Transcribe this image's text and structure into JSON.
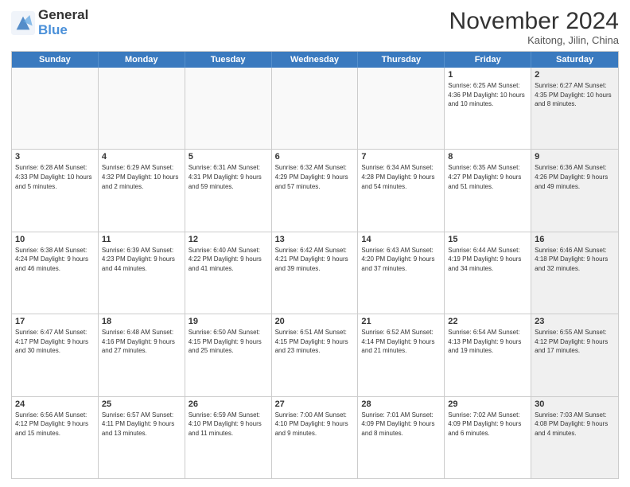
{
  "logo": {
    "line1": "General",
    "line2": "Blue"
  },
  "title": "November 2024",
  "location": "Kaitong, Jilin, China",
  "weekdays": [
    "Sunday",
    "Monday",
    "Tuesday",
    "Wednesday",
    "Thursday",
    "Friday",
    "Saturday"
  ],
  "rows": [
    [
      {
        "day": "",
        "info": "",
        "shaded": false,
        "empty": true
      },
      {
        "day": "",
        "info": "",
        "shaded": false,
        "empty": true
      },
      {
        "day": "",
        "info": "",
        "shaded": false,
        "empty": true
      },
      {
        "day": "",
        "info": "",
        "shaded": false,
        "empty": true
      },
      {
        "day": "",
        "info": "",
        "shaded": false,
        "empty": true
      },
      {
        "day": "1",
        "info": "Sunrise: 6:25 AM\nSunset: 4:36 PM\nDaylight: 10 hours and 10 minutes.",
        "shaded": false,
        "empty": false
      },
      {
        "day": "2",
        "info": "Sunrise: 6:27 AM\nSunset: 4:35 PM\nDaylight: 10 hours and 8 minutes.",
        "shaded": true,
        "empty": false
      }
    ],
    [
      {
        "day": "3",
        "info": "Sunrise: 6:28 AM\nSunset: 4:33 PM\nDaylight: 10 hours and 5 minutes.",
        "shaded": false,
        "empty": false
      },
      {
        "day": "4",
        "info": "Sunrise: 6:29 AM\nSunset: 4:32 PM\nDaylight: 10 hours and 2 minutes.",
        "shaded": false,
        "empty": false
      },
      {
        "day": "5",
        "info": "Sunrise: 6:31 AM\nSunset: 4:31 PM\nDaylight: 9 hours and 59 minutes.",
        "shaded": false,
        "empty": false
      },
      {
        "day": "6",
        "info": "Sunrise: 6:32 AM\nSunset: 4:29 PM\nDaylight: 9 hours and 57 minutes.",
        "shaded": false,
        "empty": false
      },
      {
        "day": "7",
        "info": "Sunrise: 6:34 AM\nSunset: 4:28 PM\nDaylight: 9 hours and 54 minutes.",
        "shaded": false,
        "empty": false
      },
      {
        "day": "8",
        "info": "Sunrise: 6:35 AM\nSunset: 4:27 PM\nDaylight: 9 hours and 51 minutes.",
        "shaded": false,
        "empty": false
      },
      {
        "day": "9",
        "info": "Sunrise: 6:36 AM\nSunset: 4:26 PM\nDaylight: 9 hours and 49 minutes.",
        "shaded": true,
        "empty": false
      }
    ],
    [
      {
        "day": "10",
        "info": "Sunrise: 6:38 AM\nSunset: 4:24 PM\nDaylight: 9 hours and 46 minutes.",
        "shaded": false,
        "empty": false
      },
      {
        "day": "11",
        "info": "Sunrise: 6:39 AM\nSunset: 4:23 PM\nDaylight: 9 hours and 44 minutes.",
        "shaded": false,
        "empty": false
      },
      {
        "day": "12",
        "info": "Sunrise: 6:40 AM\nSunset: 4:22 PM\nDaylight: 9 hours and 41 minutes.",
        "shaded": false,
        "empty": false
      },
      {
        "day": "13",
        "info": "Sunrise: 6:42 AM\nSunset: 4:21 PM\nDaylight: 9 hours and 39 minutes.",
        "shaded": false,
        "empty": false
      },
      {
        "day": "14",
        "info": "Sunrise: 6:43 AM\nSunset: 4:20 PM\nDaylight: 9 hours and 37 minutes.",
        "shaded": false,
        "empty": false
      },
      {
        "day": "15",
        "info": "Sunrise: 6:44 AM\nSunset: 4:19 PM\nDaylight: 9 hours and 34 minutes.",
        "shaded": false,
        "empty": false
      },
      {
        "day": "16",
        "info": "Sunrise: 6:46 AM\nSunset: 4:18 PM\nDaylight: 9 hours and 32 minutes.",
        "shaded": true,
        "empty": false
      }
    ],
    [
      {
        "day": "17",
        "info": "Sunrise: 6:47 AM\nSunset: 4:17 PM\nDaylight: 9 hours and 30 minutes.",
        "shaded": false,
        "empty": false
      },
      {
        "day": "18",
        "info": "Sunrise: 6:48 AM\nSunset: 4:16 PM\nDaylight: 9 hours and 27 minutes.",
        "shaded": false,
        "empty": false
      },
      {
        "day": "19",
        "info": "Sunrise: 6:50 AM\nSunset: 4:15 PM\nDaylight: 9 hours and 25 minutes.",
        "shaded": false,
        "empty": false
      },
      {
        "day": "20",
        "info": "Sunrise: 6:51 AM\nSunset: 4:15 PM\nDaylight: 9 hours and 23 minutes.",
        "shaded": false,
        "empty": false
      },
      {
        "day": "21",
        "info": "Sunrise: 6:52 AM\nSunset: 4:14 PM\nDaylight: 9 hours and 21 minutes.",
        "shaded": false,
        "empty": false
      },
      {
        "day": "22",
        "info": "Sunrise: 6:54 AM\nSunset: 4:13 PM\nDaylight: 9 hours and 19 minutes.",
        "shaded": false,
        "empty": false
      },
      {
        "day": "23",
        "info": "Sunrise: 6:55 AM\nSunset: 4:12 PM\nDaylight: 9 hours and 17 minutes.",
        "shaded": true,
        "empty": false
      }
    ],
    [
      {
        "day": "24",
        "info": "Sunrise: 6:56 AM\nSunset: 4:12 PM\nDaylight: 9 hours and 15 minutes.",
        "shaded": false,
        "empty": false
      },
      {
        "day": "25",
        "info": "Sunrise: 6:57 AM\nSunset: 4:11 PM\nDaylight: 9 hours and 13 minutes.",
        "shaded": false,
        "empty": false
      },
      {
        "day": "26",
        "info": "Sunrise: 6:59 AM\nSunset: 4:10 PM\nDaylight: 9 hours and 11 minutes.",
        "shaded": false,
        "empty": false
      },
      {
        "day": "27",
        "info": "Sunrise: 7:00 AM\nSunset: 4:10 PM\nDaylight: 9 hours and 9 minutes.",
        "shaded": false,
        "empty": false
      },
      {
        "day": "28",
        "info": "Sunrise: 7:01 AM\nSunset: 4:09 PM\nDaylight: 9 hours and 8 minutes.",
        "shaded": false,
        "empty": false
      },
      {
        "day": "29",
        "info": "Sunrise: 7:02 AM\nSunset: 4:09 PM\nDaylight: 9 hours and 6 minutes.",
        "shaded": false,
        "empty": false
      },
      {
        "day": "30",
        "info": "Sunrise: 7:03 AM\nSunset: 4:08 PM\nDaylight: 9 hours and 4 minutes.",
        "shaded": true,
        "empty": false
      }
    ]
  ]
}
